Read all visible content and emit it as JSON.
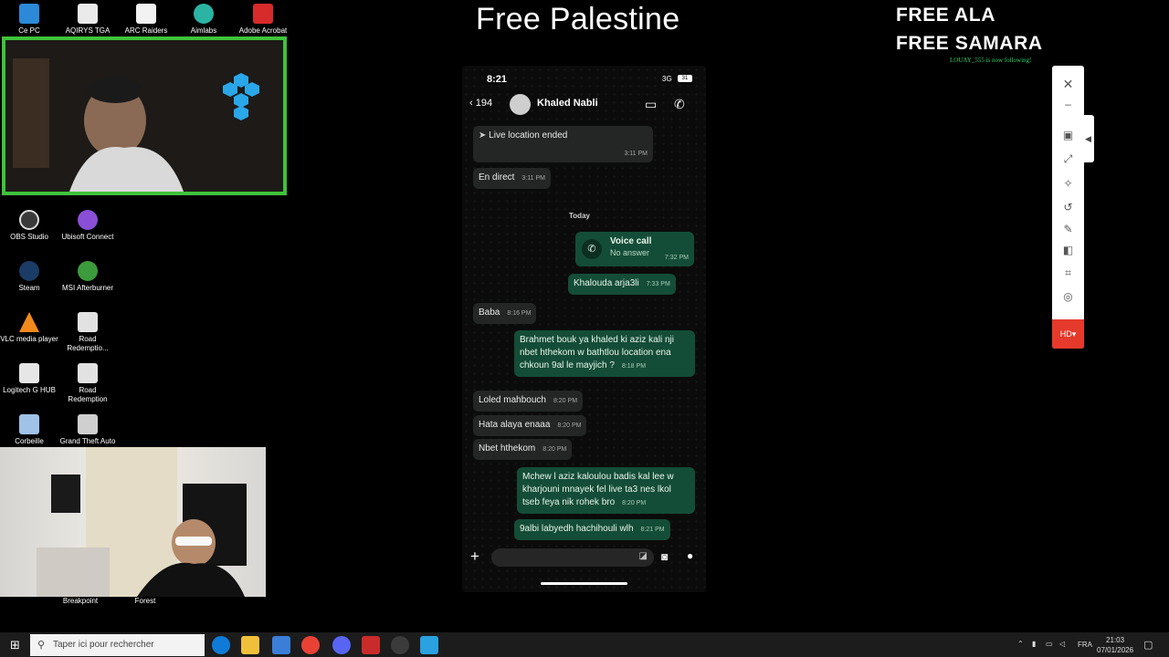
{
  "overlay": {
    "title": "Free Palestine",
    "free_line_1": "FREE ALA",
    "free_line_2": "FREE SAMARA",
    "follow_alert": "LOUAY_555 is now following!"
  },
  "desktop_icons": [
    {
      "label": "Ce PC",
      "icon": "computer-icon"
    },
    {
      "label": "AQIRYS TGA",
      "icon": "app-icon"
    },
    {
      "label": "ARC Raiders",
      "icon": "file-icon"
    },
    {
      "label": "Aimlabs",
      "icon": "aimlabs-icon"
    },
    {
      "label": "Adobe Acrobat",
      "icon": "acrobat-icon"
    },
    {
      "label": "OBS Studio",
      "icon": "obs-icon"
    },
    {
      "label": "Ubisoft Connect",
      "icon": "ubisoft-icon"
    },
    {
      "label": "Steam",
      "icon": "steam-icon"
    },
    {
      "label": "MSI Afterburner",
      "icon": "msi-icon"
    },
    {
      "label": "VLC media player",
      "icon": "vlc-icon"
    },
    {
      "label": "Road Redemptio...",
      "icon": "road-redemption-icon"
    },
    {
      "label": "Logitech G HUB",
      "icon": "logitech-icon"
    },
    {
      "label": "Road Redemption",
      "icon": "road-redemption-icon"
    },
    {
      "label": "Corbeille",
      "icon": "recycle-bin-icon"
    },
    {
      "label": "Grand Theft Auto",
      "icon": "gta-icon"
    },
    {
      "label": "Breakpoint",
      "icon": "game-icon"
    },
    {
      "label": "Forest",
      "icon": "game-icon"
    }
  ],
  "phone": {
    "status_time": "8:21",
    "network": "3G",
    "battery": "31",
    "back_count": "194",
    "contact_name": "Khaled Nabli",
    "date_separator": "Today",
    "messages": [
      {
        "dir": "in",
        "text": "Live location ended",
        "time": "3:11 PM"
      },
      {
        "dir": "in",
        "text": "En direct",
        "time": "3:11 PM"
      },
      {
        "dir": "out",
        "title": "Voice call",
        "text": "No answer",
        "time": "7:32 PM"
      },
      {
        "dir": "out",
        "text": "Khalouda arja3li",
        "time": "7:33 PM"
      },
      {
        "dir": "in",
        "text": "Baba",
        "time": "8:16 PM"
      },
      {
        "dir": "out",
        "text": "Brahmet bouk ya khaled ki aziz kali nji nbet hthekom w bathtlou location ena chkoun 9al le mayjich ?",
        "time": "8:18 PM"
      },
      {
        "dir": "in",
        "text": "Loled mahbouch",
        "time": "8:20 PM"
      },
      {
        "dir": "in",
        "text": "Hata alaya enaaa",
        "time": "8:20 PM"
      },
      {
        "dir": "in",
        "text": "Nbet hthekom",
        "time": "8:20 PM"
      },
      {
        "dir": "out",
        "text": "Mchew l aziz kaloulou badis kal lee w kharjouni mnayek fel live ta3 nes lkol tseb feya nik rohek bro",
        "time": "8:20 PM"
      },
      {
        "dir": "out",
        "text": "9albi labyedh hachihouli wlh",
        "time": "8:21 PM"
      }
    ]
  },
  "tool_panel": {
    "hd_label": "HD"
  },
  "taskbar": {
    "search_placeholder": "Taper ici pour rechercher",
    "language": "FRA",
    "clock_time": "21:03",
    "clock_date": "07/01/2026"
  },
  "colors": {
    "webcam_border": "#3fc33b",
    "bubble_out": "#144d37",
    "bubble_in": "#242626",
    "hd_button": "#e53a2b"
  }
}
